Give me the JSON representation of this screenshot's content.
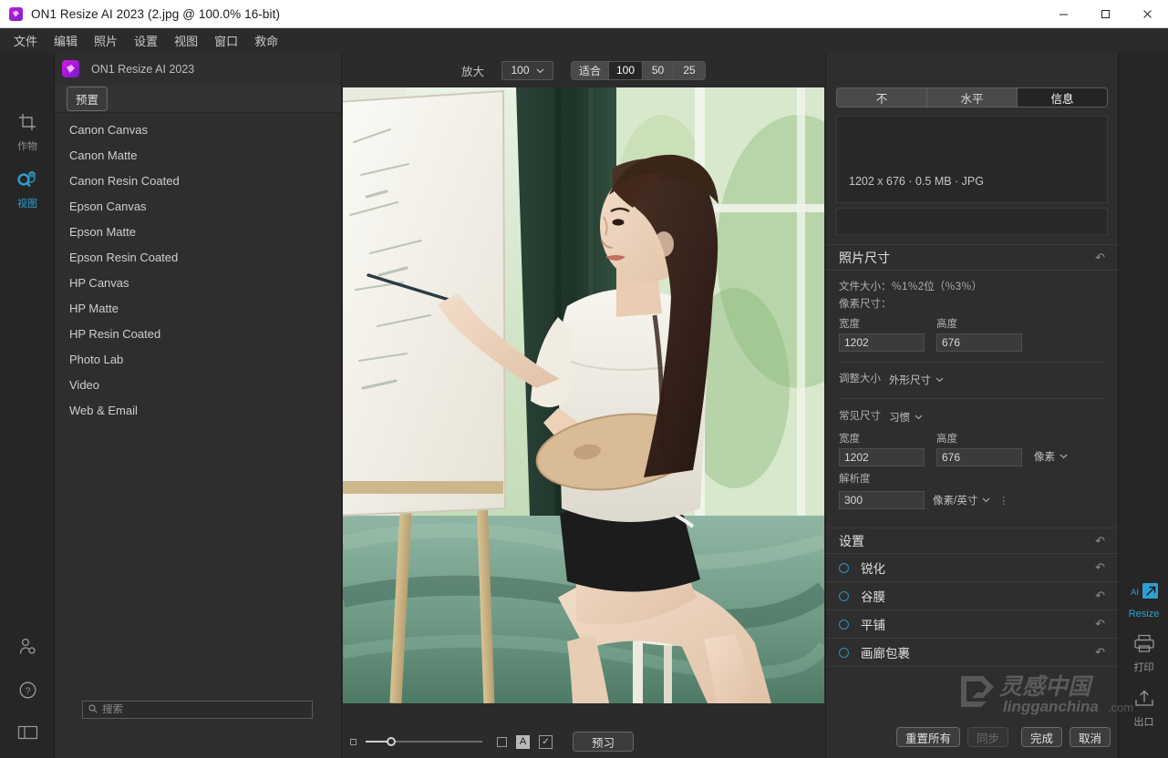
{
  "window": {
    "title": "ON1 Resize AI 2023 (2.jpg @ 100.0% 16-bit)",
    "minimize": "–",
    "maximize": "□",
    "close": "✕"
  },
  "menubar": {
    "items": [
      {
        "label": "文件"
      },
      {
        "label": "编辑"
      },
      {
        "label": "照片"
      },
      {
        "label": "设置"
      },
      {
        "label": "视图"
      },
      {
        "label": "窗口"
      },
      {
        "label": "救命"
      }
    ]
  },
  "left_rail": {
    "tools": [
      {
        "name": "crop",
        "label": "作物",
        "active": false
      },
      {
        "name": "view",
        "label": "视图",
        "active": true
      }
    ],
    "bottom_icons": [
      "user-settings-icon",
      "help-icon",
      "panel-layout-icon"
    ]
  },
  "left_panel": {
    "brand": "ON1 Resize AI 2023",
    "preset_tab": "预置",
    "presets": [
      {
        "label": "Canon Canvas"
      },
      {
        "label": "Canon Matte"
      },
      {
        "label": "Canon Resin Coated"
      },
      {
        "label": "Epson Canvas"
      },
      {
        "label": "Epson Matte"
      },
      {
        "label": "Epson Resin Coated"
      },
      {
        "label": "HP Canvas"
      },
      {
        "label": "HP Matte"
      },
      {
        "label": "HP Resin Coated"
      },
      {
        "label": "Photo Lab"
      },
      {
        "label": "Video"
      },
      {
        "label": "Web & Email"
      }
    ],
    "search": {
      "placeholder": "搜索",
      "value": ""
    }
  },
  "zoom_toolbar": {
    "label": "放大",
    "value": "100",
    "segments": [
      {
        "label": "适合",
        "selected": false
      },
      {
        "label": "100",
        "selected": true
      },
      {
        "label": "50",
        "selected": false
      },
      {
        "label": "25",
        "selected": false
      }
    ]
  },
  "bottom_bar": {
    "preview_button": "预习",
    "letter_button": "A",
    "check_button": "✓"
  },
  "right_panel": {
    "tabs": [
      {
        "label": "不",
        "selected": false
      },
      {
        "label": "水平",
        "selected": false
      },
      {
        "label": "信息",
        "selected": true
      }
    ],
    "info_line": "1202 x 676 · 0.5 MB · JPG",
    "photo_size": {
      "title": "照片尺寸",
      "file_size_line": "文件大小：％1％2位（％3％）",
      "pixel_dims_label": "像素尺寸：",
      "width_label": "宽度",
      "height_label": "高度",
      "width_value": "1202",
      "height_value": "676",
      "resize_label": "调整大小",
      "resize_value": "外形尺寸",
      "common_label": "常见尺寸",
      "common_value": "习惯",
      "out_width_label": "宽度",
      "out_height_label": "高度",
      "out_width_value": "1202",
      "out_height_value": "676",
      "unit_value": "像素",
      "resolution_label": "解析度",
      "resolution_value": "300",
      "resolution_unit": "像素/英寸"
    },
    "settings": {
      "title": "设置",
      "options": [
        {
          "label": "锐化"
        },
        {
          "label": "谷膜"
        },
        {
          "label": "平铺"
        },
        {
          "label": "画廊包裹"
        }
      ]
    },
    "actions": {
      "reset_all": "重置所有",
      "sync": "同步",
      "done": "完成",
      "cancel": "取消"
    }
  },
  "right_rail": {
    "items": [
      {
        "name": "ai-resize",
        "label": "Resize",
        "badge": "AI",
        "active": true
      },
      {
        "name": "print",
        "label": "打印",
        "active": false
      },
      {
        "name": "export",
        "label": "出口",
        "active": false
      }
    ]
  },
  "watermark": {
    "text_cn": "灵感中国",
    "text_en": "lingganchina",
    "text_tld": ".com"
  },
  "colors": {
    "accent": "#2f9fd0",
    "panel": "#2e2e2e",
    "background": "#2b2b2b",
    "titlebar": "#ffffff",
    "brand_purple": "#c21fd6"
  }
}
